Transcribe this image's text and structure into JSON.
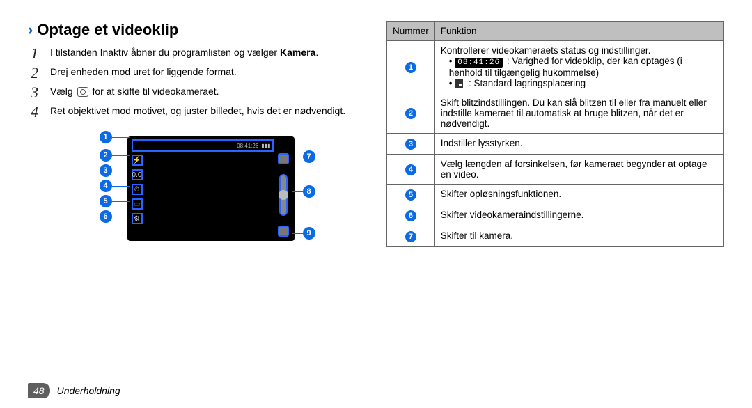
{
  "heading": "Optage et videoklip",
  "steps": {
    "s1a": "I tilstanden Inaktiv åbner du programlisten og vælger ",
    "s1b": "Kamera",
    "s1c": ".",
    "s2": "Drej enheden mod uret for liggende format.",
    "s3a": "Vælg ",
    "s3b": " for at skifte til videokameraet.",
    "s4": "Ret objektivet mod motivet, og juster billedet, hvis det er nødvendigt."
  },
  "diagram": {
    "time": "08:41:26",
    "labels": [
      "1",
      "2",
      "3",
      "4",
      "5",
      "6",
      "7",
      "8",
      "9"
    ]
  },
  "table": {
    "h1": "Nummer",
    "h2": "Funktion",
    "r1": {
      "a": "Kontrollerer videokameraets status og indstillinger.",
      "b_time": "08:41:26",
      "b": " : Varighed for videoklip, der kan optages (i henhold til tilgængelig hukommelse)",
      "c": " : Standard lagringsplacering"
    },
    "r2": "Skift blitzindstillingen. Du kan slå blitzen til eller fra manuelt eller indstille kameraet til automatisk at bruge blitzen, når det er nødvendigt.",
    "r3": "Indstiller lysstyrken.",
    "r4": "Vælg længden af forsinkelsen, før kameraet begynder at optage en video.",
    "r5": "Skifter opløsningsfunktionen.",
    "r6": "Skifter videokameraindstillingerne.",
    "r7": "Skifter til kamera."
  },
  "footer": {
    "page": "48",
    "section": "Underholdning"
  }
}
